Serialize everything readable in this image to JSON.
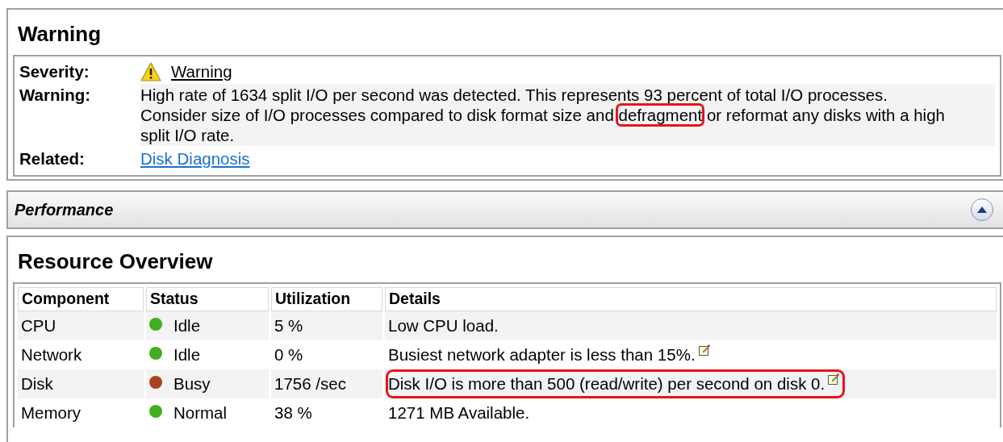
{
  "warning_panel": {
    "title": "Warning",
    "severity": {
      "label": "Severity:",
      "value": "Warning"
    },
    "message": {
      "label": "Warning:",
      "segments": [
        {
          "text": "High rate of 1634 split I/O per second was detected. This represents 93 percent of total I/O processes. Consider size of I/O processes compared to disk format size and ",
          "highlighted": false
        },
        {
          "text": "defragment",
          "highlighted": true
        },
        {
          "text": " or reformat any disks with a high split I/O rate.",
          "highlighted": false
        }
      ]
    },
    "related": {
      "label": "Related:",
      "link": "Disk Diagnosis"
    }
  },
  "performance_bar": {
    "title": "Performance",
    "expanded": true
  },
  "resource_overview": {
    "title": "Resource Overview",
    "columns": [
      "Component",
      "Status",
      "Utilization",
      "Details"
    ],
    "rows": [
      {
        "component": "CPU",
        "status": "Idle",
        "color": "#3fae1f",
        "utilization": "5 %",
        "details": "Low CPU load.",
        "note": false,
        "highlighted": false
      },
      {
        "component": "Network",
        "status": "Idle",
        "color": "#3fae1f",
        "utilization": "0 %",
        "details": "Busiest network adapter is less than 15%.",
        "note": true,
        "highlighted": false
      },
      {
        "component": "Disk",
        "status": "Busy",
        "color": "#a9431f",
        "utilization": "1756 /sec",
        "details": "Disk I/O is more than 500 (read/write) per second on disk 0.",
        "note": true,
        "highlighted": true
      },
      {
        "component": "Memory",
        "status": "Normal",
        "color": "#3fae1f",
        "utilization": "38 %",
        "details": "1271 MB Available.",
        "note": false,
        "highlighted": false
      }
    ]
  }
}
